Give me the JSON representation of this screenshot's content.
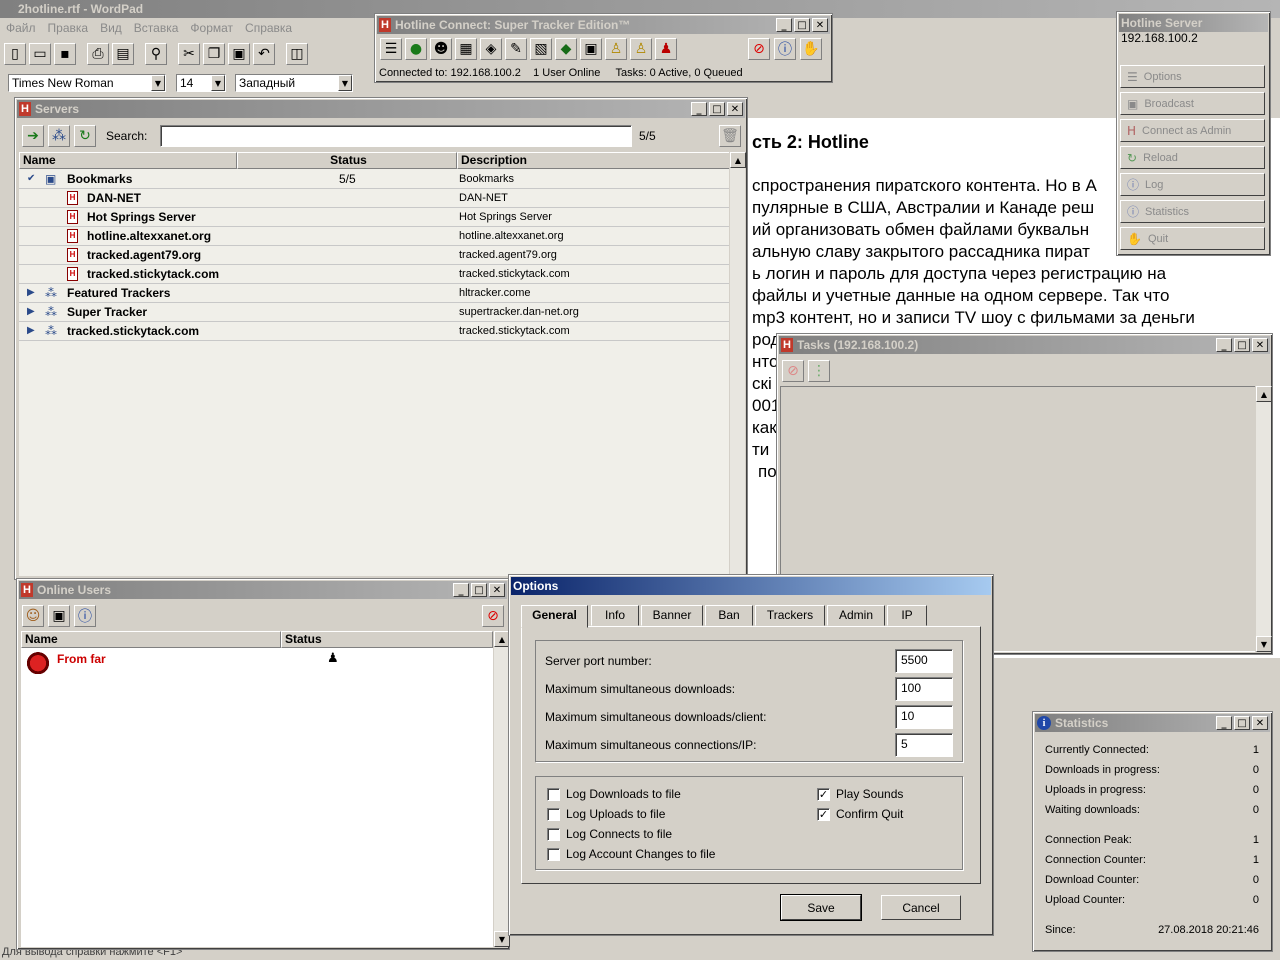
{
  "wordpad": {
    "title": "2hotline.rtf - WordPad",
    "menu": [
      "Файл",
      "Правка",
      "Вид",
      "Вставка",
      "Формат",
      "Справка"
    ],
    "font": "Times New Roman",
    "size": "14",
    "script": "Западный",
    "heading": "сть 2: Hotline",
    "lines": [
      "спространения пиратского контента. Но в А",
      "пулярные в США, Австралии и Канаде реш",
      "ий организовать обмен файлами буквальн",
      "альную славу закрытого рассадника пират",
      "ь логин и пароль для доступа через регистрацию на",
      "файлы и учетные данные на одном сервере. Так что",
      "mp3 контент, но и записи TV шоу с фильмами за деньги",
      "род",
      "нто",
      "скі",
      "001",
      "как",
      "ти",
      "по"
    ],
    "status_bar": "Для вывода справки нажмите <F1>"
  },
  "hotline_connect": {
    "title": "Hotline Connect: Super Tracker Edition™",
    "status": "Connected to: 192.168.100.2    1 User Online     Tasks: 0 Active, 0 Queued"
  },
  "hotline_server": {
    "title": "Hotline Server",
    "ip": "192.168.100.2",
    "buttons": [
      {
        "label": "Options",
        "icon": "options-icon"
      },
      {
        "label": "Broadcast",
        "icon": "broadcast-icon"
      },
      {
        "label": "Connect as Admin",
        "icon": "admin-icon"
      },
      {
        "label": "Reload",
        "icon": "reload-icon"
      },
      {
        "label": "Log",
        "icon": "log-icon"
      },
      {
        "label": "Statistics",
        "icon": "statistics-icon"
      },
      {
        "label": "Quit",
        "icon": "quit-icon"
      }
    ]
  },
  "servers": {
    "title": "Servers",
    "search_label": "Search:",
    "count": "5/5",
    "columns": [
      "Name",
      "Status",
      "Description"
    ],
    "rows": [
      {
        "name": "Bookmarks",
        "status": "5/5",
        "desc": "Bookmarks"
      },
      {
        "name": "DAN-NET",
        "status": "",
        "desc": "DAN-NET"
      },
      {
        "name": "Hot Springs Server",
        "status": "",
        "desc": "Hot Springs Server"
      },
      {
        "name": "hotline.altexxanet.org",
        "status": "",
        "desc": "hotline.altexxanet.org"
      },
      {
        "name": "tracked.agent79.org",
        "status": "",
        "desc": "tracked.agent79.org"
      },
      {
        "name": "tracked.stickytack.com",
        "status": "",
        "desc": "tracked.stickytack.com"
      },
      {
        "name": "Featured Trackers",
        "status": "",
        "desc": "hltracker.come"
      },
      {
        "name": "Super Tracker",
        "status": "",
        "desc": "supertracker.dan-net.org"
      },
      {
        "name": "tracked.stickytack.com",
        "status": "",
        "desc": "tracked.stickytack.com"
      }
    ]
  },
  "online_users": {
    "title": "Online Users",
    "columns": [
      "Name",
      "Status"
    ],
    "users": [
      {
        "name": "From far"
      }
    ]
  },
  "tasks": {
    "title": "Tasks (192.168.100.2)"
  },
  "options": {
    "title": "Options",
    "tabs": [
      "General",
      "Info",
      "Banner",
      "Ban",
      "Trackers",
      "Admin",
      "IP"
    ],
    "fields": [
      {
        "label": "Server port number:",
        "value": "5500"
      },
      {
        "label": "Maximum simultaneous downloads:",
        "value": "100"
      },
      {
        "label": "Maximum simultaneous downloads/client:",
        "value": "10"
      },
      {
        "label": "Maximum simultaneous connections/IP:",
        "value": "5"
      }
    ],
    "checks_left": [
      {
        "label": "Log Downloads to file",
        "checked": false
      },
      {
        "label": "Log Uploads to file",
        "checked": false
      },
      {
        "label": "Log Connects to file",
        "checked": false
      },
      {
        "label": "Log Account Changes to file",
        "checked": false
      }
    ],
    "checks_right": [
      {
        "label": "Play Sounds",
        "checked": true
      },
      {
        "label": "Confirm Quit",
        "checked": true
      }
    ],
    "save": "Save",
    "cancel": "Cancel"
  },
  "statistics": {
    "title": "Statistics",
    "rows": [
      {
        "label": "Currently Connected:",
        "value": "1"
      },
      {
        "label": "Downloads in progress:",
        "value": "0"
      },
      {
        "label": "Uploads in progress:",
        "value": "0"
      },
      {
        "label": "Waiting downloads:",
        "value": "0"
      },
      {
        "label": "Connection Peak:",
        "value": "1"
      },
      {
        "label": "Connection Counter:",
        "value": "1"
      },
      {
        "label": "Download Counter:",
        "value": "0"
      },
      {
        "label": "Upload Counter:",
        "value": "0"
      },
      {
        "label": "Since:",
        "value": "27.08.2018 20:21:46"
      }
    ]
  }
}
